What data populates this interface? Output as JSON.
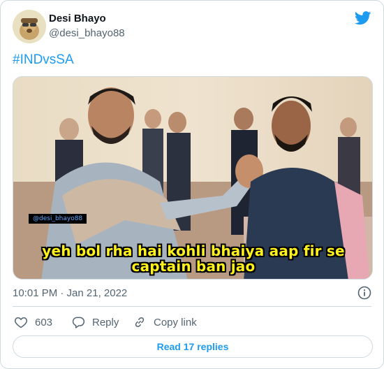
{
  "author": {
    "name": "Desi Bhayo",
    "handle": "@desi_bhayo88"
  },
  "tweet": {
    "hashtag": "#INDvsSA",
    "timestamp": "10:01 PM · Jan 21, 2022"
  },
  "media": {
    "watermark": "@desi_bhayo88",
    "caption_line1": "yeh bol rha hai kohli bhaiya aap fir se",
    "caption_line2": "captain ban jao"
  },
  "actions": {
    "like_count": "603",
    "reply_label": "Reply",
    "copy_link_label": "Copy link"
  },
  "read_replies_label": "Read 17 replies",
  "colors": {
    "accent": "#1d9bf0",
    "text_secondary": "#536471",
    "border": "#cfd9de",
    "caption_yellow": "#fff21a"
  },
  "icons": [
    "twitter-bird-icon",
    "info-icon",
    "heart-icon",
    "reply-bubble-icon",
    "link-icon"
  ]
}
